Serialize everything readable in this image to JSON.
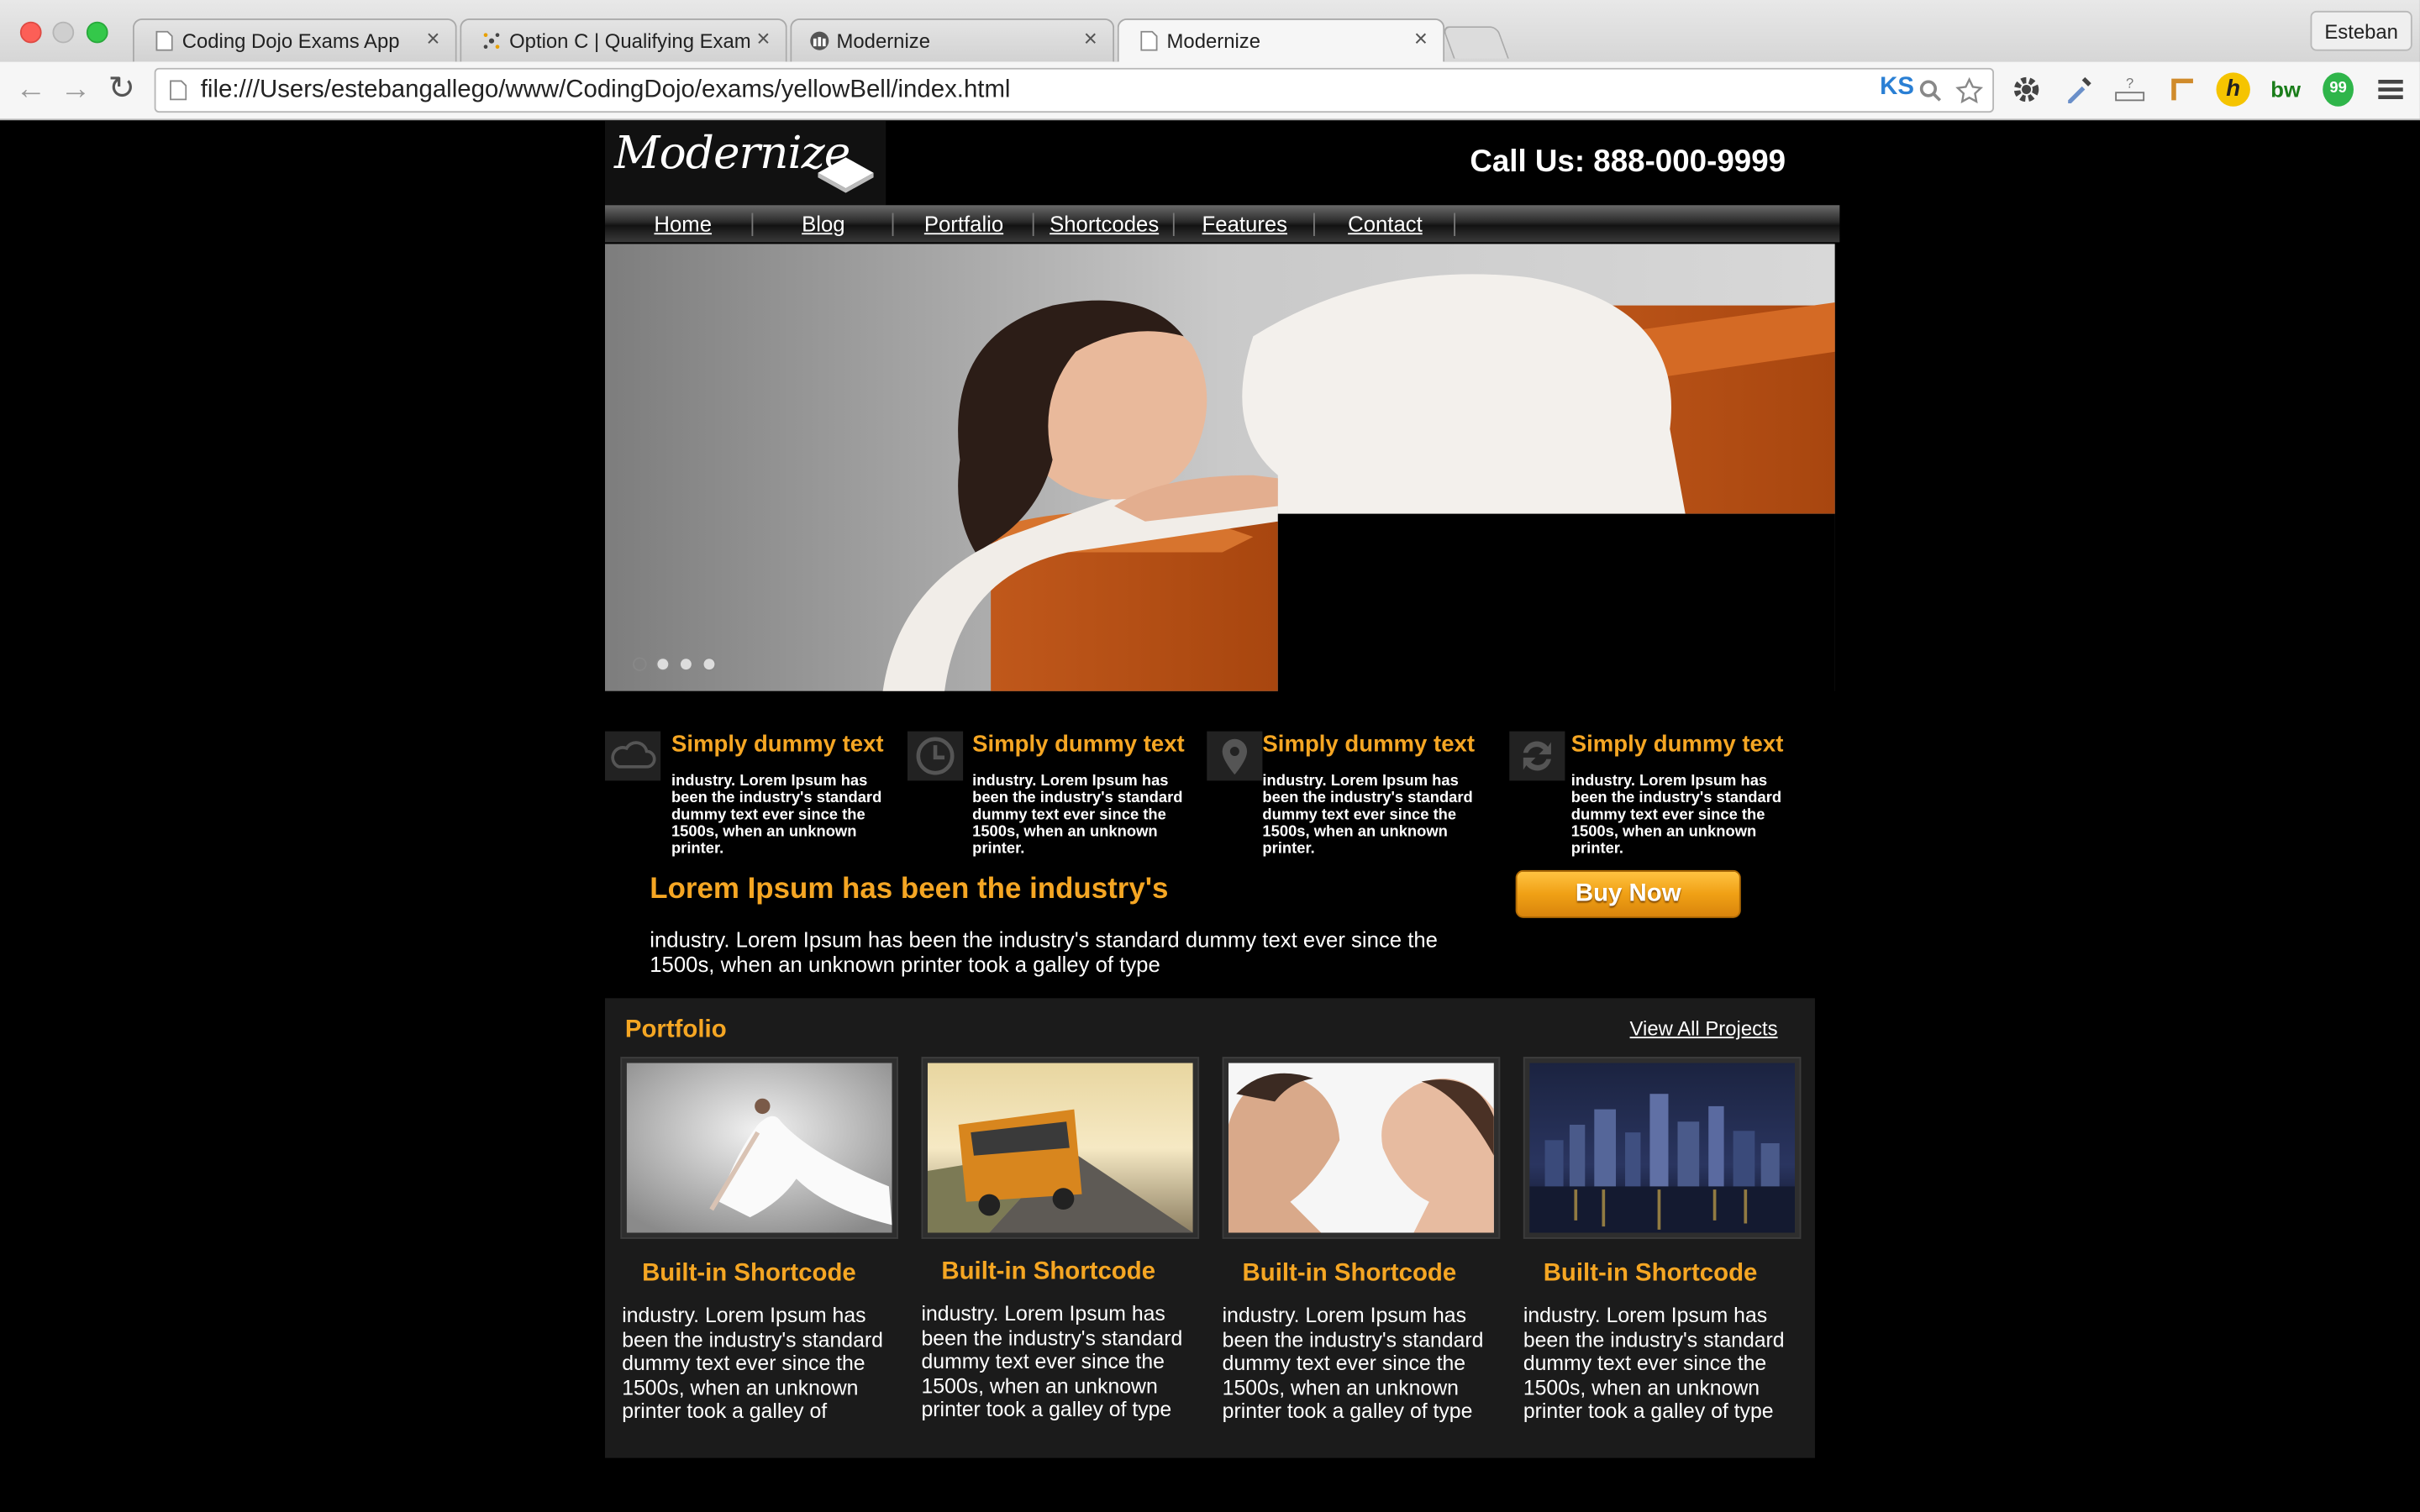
{
  "browser": {
    "tabs": [
      {
        "title": "Coding Dojo Exams App",
        "close": "×"
      },
      {
        "title": "Option C | Qualifying Exam",
        "close": "×"
      },
      {
        "title": "Modernize",
        "close": "×"
      },
      {
        "title": "Modernize",
        "close": "×"
      }
    ],
    "profile_name": "Esteban",
    "url": "file:///Users/estebangallego/www/CodingDojo/exams/yellowBell/index.html",
    "back_glyph": "←",
    "forward_glyph": "→",
    "reload_glyph": "↻",
    "extensions": [
      "KS",
      "h",
      "bw",
      "99"
    ]
  },
  "site": {
    "logo_text": "Modernize",
    "call_us": "Call Us: 888-000-9999",
    "nav": [
      "Home",
      "Blog",
      "Portfalio",
      "Shortcodes",
      "Features",
      "Contact"
    ],
    "slider_dot_count": 4,
    "features": [
      {
        "icon": "cloud-icon",
        "title": "Simply dummy text",
        "text": "industry. Lorem Ipsum has been the industry's standard dummy text ever since the 1500s, when an unknown printer."
      },
      {
        "icon": "clock-icon",
        "title": "Simply dummy text",
        "text": "industry. Lorem Ipsum has been the industry's standard dummy text ever since the 1500s, when an unknown printer."
      },
      {
        "icon": "location-pin-icon",
        "title": "Simply dummy text",
        "text": "industry. Lorem Ipsum has been the industry's standard dummy text ever since the 1500s, when an unknown printer."
      },
      {
        "icon": "refresh-icon",
        "title": "Simply dummy text",
        "text": "industry. Lorem Ipsum has been the industry's standard dummy text ever since the 1500s, when an unknown printer."
      }
    ],
    "headline": "Lorem Ipsum has been the industry's",
    "headline_text": "industry. Lorem Ipsum has been the industry's standard dummy text ever since the 1500s, when an unknown printer took a galley of type",
    "buy_button": "Buy Now",
    "portfolio": {
      "title": "Portfolio",
      "view_all": "View All Projects",
      "items": [
        {
          "caption": "Built-in Shortcode",
          "text": "industry. Lorem Ipsum has been the industry's standard dummy text ever since the 1500s, when an unknown printer took a galley of"
        },
        {
          "caption": "Built-in Shortcode",
          "text": "industry. Lorem Ipsum has been the industry's standard dummy text ever since the 1500s, when an unknown printer took a galley of type"
        },
        {
          "caption": "Built-in Shortcode",
          "text": "industry. Lorem Ipsum has been the industry's standard dummy text ever since the 1500s, when an unknown printer took a galley of type"
        },
        {
          "caption": "Built-in Shortcode",
          "text": "industry. Lorem Ipsum has been the industry's standard dummy text ever since the 1500s, when an unknown printer took a galley of type"
        }
      ]
    }
  },
  "colors": {
    "accent": "#f5a623",
    "background": "#000000",
    "panel": "#1b1b1b"
  }
}
